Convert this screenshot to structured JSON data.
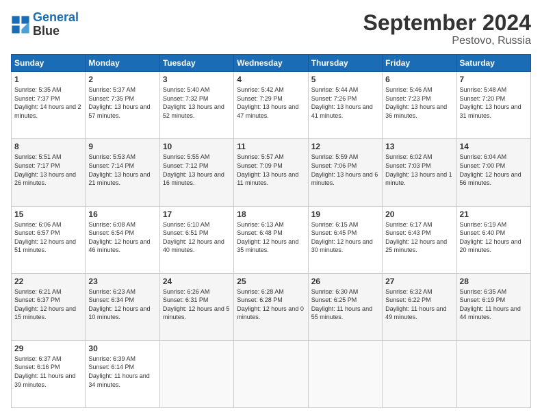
{
  "logo": {
    "line1": "General",
    "line2": "Blue"
  },
  "title": "September 2024",
  "subtitle": "Pestovo, Russia",
  "headers": [
    "Sunday",
    "Monday",
    "Tuesday",
    "Wednesday",
    "Thursday",
    "Friday",
    "Saturday"
  ],
  "weeks": [
    [
      {
        "day": "1",
        "sunrise": "Sunrise: 5:35 AM",
        "sunset": "Sunset: 7:37 PM",
        "daylight": "Daylight: 14 hours and 2 minutes."
      },
      {
        "day": "2",
        "sunrise": "Sunrise: 5:37 AM",
        "sunset": "Sunset: 7:35 PM",
        "daylight": "Daylight: 13 hours and 57 minutes."
      },
      {
        "day": "3",
        "sunrise": "Sunrise: 5:40 AM",
        "sunset": "Sunset: 7:32 PM",
        "daylight": "Daylight: 13 hours and 52 minutes."
      },
      {
        "day": "4",
        "sunrise": "Sunrise: 5:42 AM",
        "sunset": "Sunset: 7:29 PM",
        "daylight": "Daylight: 13 hours and 47 minutes."
      },
      {
        "day": "5",
        "sunrise": "Sunrise: 5:44 AM",
        "sunset": "Sunset: 7:26 PM",
        "daylight": "Daylight: 13 hours and 41 minutes."
      },
      {
        "day": "6",
        "sunrise": "Sunrise: 5:46 AM",
        "sunset": "Sunset: 7:23 PM",
        "daylight": "Daylight: 13 hours and 36 minutes."
      },
      {
        "day": "7",
        "sunrise": "Sunrise: 5:48 AM",
        "sunset": "Sunset: 7:20 PM",
        "daylight": "Daylight: 13 hours and 31 minutes."
      }
    ],
    [
      {
        "day": "8",
        "sunrise": "Sunrise: 5:51 AM",
        "sunset": "Sunset: 7:17 PM",
        "daylight": "Daylight: 13 hours and 26 minutes."
      },
      {
        "day": "9",
        "sunrise": "Sunrise: 5:53 AM",
        "sunset": "Sunset: 7:14 PM",
        "daylight": "Daylight: 13 hours and 21 minutes."
      },
      {
        "day": "10",
        "sunrise": "Sunrise: 5:55 AM",
        "sunset": "Sunset: 7:12 PM",
        "daylight": "Daylight: 13 hours and 16 minutes."
      },
      {
        "day": "11",
        "sunrise": "Sunrise: 5:57 AM",
        "sunset": "Sunset: 7:09 PM",
        "daylight": "Daylight: 13 hours and 11 minutes."
      },
      {
        "day": "12",
        "sunrise": "Sunrise: 5:59 AM",
        "sunset": "Sunset: 7:06 PM",
        "daylight": "Daylight: 13 hours and 6 minutes."
      },
      {
        "day": "13",
        "sunrise": "Sunrise: 6:02 AM",
        "sunset": "Sunset: 7:03 PM",
        "daylight": "Daylight: 13 hours and 1 minute."
      },
      {
        "day": "14",
        "sunrise": "Sunrise: 6:04 AM",
        "sunset": "Sunset: 7:00 PM",
        "daylight": "Daylight: 12 hours and 56 minutes."
      }
    ],
    [
      {
        "day": "15",
        "sunrise": "Sunrise: 6:06 AM",
        "sunset": "Sunset: 6:57 PM",
        "daylight": "Daylight: 12 hours and 51 minutes."
      },
      {
        "day": "16",
        "sunrise": "Sunrise: 6:08 AM",
        "sunset": "Sunset: 6:54 PM",
        "daylight": "Daylight: 12 hours and 46 minutes."
      },
      {
        "day": "17",
        "sunrise": "Sunrise: 6:10 AM",
        "sunset": "Sunset: 6:51 PM",
        "daylight": "Daylight: 12 hours and 40 minutes."
      },
      {
        "day": "18",
        "sunrise": "Sunrise: 6:13 AM",
        "sunset": "Sunset: 6:48 PM",
        "daylight": "Daylight: 12 hours and 35 minutes."
      },
      {
        "day": "19",
        "sunrise": "Sunrise: 6:15 AM",
        "sunset": "Sunset: 6:45 PM",
        "daylight": "Daylight: 12 hours and 30 minutes."
      },
      {
        "day": "20",
        "sunrise": "Sunrise: 6:17 AM",
        "sunset": "Sunset: 6:43 PM",
        "daylight": "Daylight: 12 hours and 25 minutes."
      },
      {
        "day": "21",
        "sunrise": "Sunrise: 6:19 AM",
        "sunset": "Sunset: 6:40 PM",
        "daylight": "Daylight: 12 hours and 20 minutes."
      }
    ],
    [
      {
        "day": "22",
        "sunrise": "Sunrise: 6:21 AM",
        "sunset": "Sunset: 6:37 PM",
        "daylight": "Daylight: 12 hours and 15 minutes."
      },
      {
        "day": "23",
        "sunrise": "Sunrise: 6:23 AM",
        "sunset": "Sunset: 6:34 PM",
        "daylight": "Daylight: 12 hours and 10 minutes."
      },
      {
        "day": "24",
        "sunrise": "Sunrise: 6:26 AM",
        "sunset": "Sunset: 6:31 PM",
        "daylight": "Daylight: 12 hours and 5 minutes."
      },
      {
        "day": "25",
        "sunrise": "Sunrise: 6:28 AM",
        "sunset": "Sunset: 6:28 PM",
        "daylight": "Daylight: 12 hours and 0 minutes."
      },
      {
        "day": "26",
        "sunrise": "Sunrise: 6:30 AM",
        "sunset": "Sunset: 6:25 PM",
        "daylight": "Daylight: 11 hours and 55 minutes."
      },
      {
        "day": "27",
        "sunrise": "Sunrise: 6:32 AM",
        "sunset": "Sunset: 6:22 PM",
        "daylight": "Daylight: 11 hours and 49 minutes."
      },
      {
        "day": "28",
        "sunrise": "Sunrise: 6:35 AM",
        "sunset": "Sunset: 6:19 PM",
        "daylight": "Daylight: 11 hours and 44 minutes."
      }
    ],
    [
      {
        "day": "29",
        "sunrise": "Sunrise: 6:37 AM",
        "sunset": "Sunset: 6:16 PM",
        "daylight": "Daylight: 11 hours and 39 minutes."
      },
      {
        "day": "30",
        "sunrise": "Sunrise: 6:39 AM",
        "sunset": "Sunset: 6:14 PM",
        "daylight": "Daylight: 11 hours and 34 minutes."
      },
      null,
      null,
      null,
      null,
      null
    ]
  ]
}
